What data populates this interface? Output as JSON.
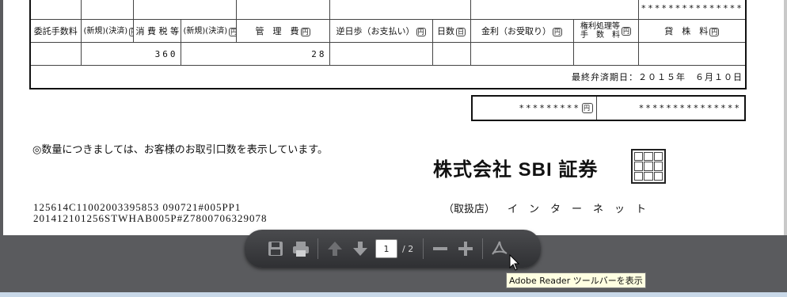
{
  "trade_table": {
    "top_right_stars": "***************",
    "headers": {
      "commission": "委託手数料",
      "commission_sub": "(新規)(決済)",
      "tax": "消 費 税 等",
      "tax_sub": "(新規)(決済)",
      "mgmt": "管　理　費",
      "reverse": "逆日歩（お支払い）",
      "days": "日数",
      "interest": "金利（お受取り）",
      "rights1": "権利処理等",
      "rights2": "手　数　料",
      "lending": "貸　株　料",
      "yen": "円",
      "day_unit": "日"
    },
    "values": {
      "commission": "360",
      "tax": "28"
    },
    "due_label": "最終弁済期日：２０１５年　６月１０日"
  },
  "summary_box": {
    "a": "*********",
    "b": "***************",
    "yen": "円"
  },
  "note": "◎数量につきましては、お客様のお取引口数を表示しています。",
  "company": "株式会社 SBI 証券",
  "handler": {
    "label": "（取扱店）",
    "value": "インターネット"
  },
  "codes": {
    "line1": "125614C11002003395853  090721#005PP1",
    "line2": "201412101256STWHAB005P#Z7800706329078"
  },
  "toolbar": {
    "current_page": "1",
    "total_pages": "/ 2",
    "tooltip": "Adobe Reader ツールバーを表示"
  }
}
